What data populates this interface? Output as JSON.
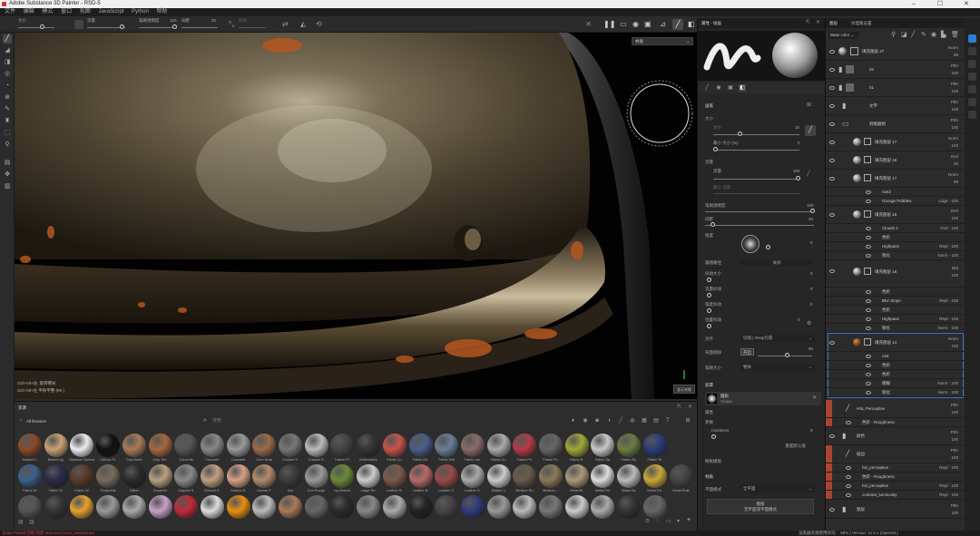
{
  "window": {
    "title": "Adobe Substance 3D Painter - RSD-5",
    "minimize": "–",
    "maximize": "☐",
    "close": "✕"
  },
  "menu": [
    "文件",
    "编辑",
    "模式",
    "窗口",
    "视图",
    "JavaScript",
    "Python",
    "帮助"
  ],
  "tool_options": {
    "size_label": "大小",
    "flow_label": "流量",
    "opacity_label": "笔刷透明度",
    "opacity_value": "100",
    "spacing_label": "间距",
    "spacing_value": "20",
    "jitter_label": "抖动",
    "symmetry_label": "对称"
  },
  "viewport": {
    "dropdown": "材质",
    "hint1": "Ctrl+Alt+左: 旋转曝光",
    "hint2": "Ctrl+Alt+左 平移平整 (#0 )",
    "button": "显示光照"
  },
  "properties": {
    "tabs": [
      "属性 - 绘画"
    ],
    "section_brush": "画笔",
    "size_label": "大小",
    "size_sub": "大小",
    "size_value": "10",
    "size_jitter_label": "最小 大小 (%)",
    "size_jitter_value": "0",
    "flow_section": "流量",
    "flow_label": "流量",
    "flow_value": "100",
    "flow_min_label": "最小 流量",
    "flow_min_value": "",
    "opacity_label": "笔刷透明度",
    "opacity_value": "100",
    "spacing_label": "间距",
    "spacing_value": "20",
    "angle_label": "角度",
    "angle_value": "0",
    "follow_label": "跟随路径",
    "follow_value": "关闭",
    "size_jitter2": "抖动大小",
    "size_jitter2_value": "0",
    "flow_jitter": "流量抖动",
    "flow_jitter_value": "0",
    "angle_jitter": "角度抖动",
    "angle_jitter_value": "0",
    "pos_jitter": "位置抖动",
    "pos_jitter_value": "0",
    "alignment_label": "对齐",
    "alignment_value": "切线 | Wrap包裹",
    "backface_label": "背面剔除",
    "backface_value": "开启",
    "backface_num": "90",
    "symmetry_label": "笔刷大小",
    "symmetry_value": "物体",
    "alpha_section": "遮罩",
    "alpha_name": "圆形",
    "alpha_type": "Shape",
    "alpha_attr": "属性",
    "params": "参数",
    "hardness": "Hardness",
    "hardness_value": "0",
    "reset": "重置默认值",
    "stencil": "网格模版",
    "material": "材质",
    "material_mode": "平面模式",
    "material_value": "全平面",
    "bottom_btn_1": "模版",
    "bottom_btn_2": "无平面或平面模式"
  },
  "layers": {
    "tabs": [
      "图层",
      "纹理集设置"
    ],
    "base_color": "Base color",
    "rows": [
      {
        "name": "填充图层 27",
        "blend": "Norm",
        "val": "98",
        "type": "layer"
      },
      {
        "name": "02",
        "blend": "Pthr",
        "val": "100",
        "type": "folder"
      },
      {
        "name": "01",
        "blend": "Pthr",
        "val": "100",
        "type": "folder"
      },
      {
        "name": "文字",
        "blend": "Pthr",
        "val": "100",
        "type": "folder"
      },
      {
        "name": "划痕磨损",
        "blend": "Pthr",
        "val": "100",
        "type": "folder"
      },
      {
        "name": "填充图层 17",
        "blend": "Norm",
        "val": "100",
        "type": "layer"
      },
      {
        "name": "填充图层 16",
        "blend": "Ovrl",
        "val": "26",
        "type": "layer"
      },
      {
        "name": "填充图层 17",
        "blend": "Norm",
        "val": "89",
        "type": "layer"
      }
    ],
    "subrows_a": [
      {
        "name": "rust2",
        "blend": ""
      },
      {
        "name": "Grunge Pebbles",
        "blend": "Ldge · 100"
      }
    ],
    "rows2": [
      {
        "name": "填充图层 15",
        "blend": "Ovrl",
        "val": "100"
      }
    ],
    "subrows_b": [
      {
        "name": "Clouds 2",
        "blend": "Ovrl · 100"
      },
      {
        "name": "色阶",
        "blend": ""
      },
      {
        "name": "Highpass",
        "blend": "Repl · 100"
      },
      {
        "name": "锐化",
        "blend": "Norm · 100"
      }
    ],
    "rows3": [
      {
        "name": "填充图层 16",
        "blend": "Mul",
        "val": "100"
      }
    ],
    "subrows_c": [
      {
        "name": "色阶",
        "blend": ""
      },
      {
        "name": "Blur Slope",
        "blend": "Repl · 100"
      },
      {
        "name": "色阶",
        "blend": ""
      },
      {
        "name": "Highpass",
        "blend": "Repl · 100"
      },
      {
        "name": "锐化",
        "blend": "Norm · 100"
      }
    ],
    "rows4": [
      {
        "name": "填充图层 14",
        "blend": "Norm",
        "val": "100"
      }
    ],
    "subrows_d": [
      {
        "name": "rust",
        "blend": ""
      },
      {
        "name": "色阶",
        "blend": ""
      },
      {
        "name": "色阶",
        "blend": ""
      },
      {
        "name": "模糊",
        "blend": "Norm · 100"
      },
      {
        "name": "锐化",
        "blend": "Norm · 100"
      }
    ],
    "rows5": [
      {
        "name": "HSL Perceptive",
        "blend": "Pthr",
        "val": "100"
      }
    ],
    "subrows_e": [
      {
        "name": "色阶 - Roughness",
        "blend": ""
      }
    ],
    "rows6": [
      {
        "name": "颜色",
        "blend": "Pthr",
        "val": "100"
      },
      {
        "name": "描边",
        "blend": "Pthr",
        "val": "100"
      }
    ],
    "subrows_f": [
      {
        "name": "hsl_perceptive",
        "blend": "Repl · 100"
      },
      {
        "name": "色阶 - Roughness",
        "blend": ""
      },
      {
        "name": "hsl_perceptive",
        "blend": "Repl · 100"
      },
      {
        "name": "contrast_luminosity",
        "blend": "Repl · 100"
      }
    ],
    "rows7": [
      {
        "name": "图层",
        "blend": "Pthr",
        "val": "100"
      }
    ]
  },
  "shelf": {
    "title": "资源",
    "filter": "All libraries",
    "search_placeholder": "搜索",
    "row1": [
      "Autumn L.",
      "Baked Lig.",
      "Balance Contrast",
      "Carbon Fi.",
      "Clay Earth",
      "Clay Terr.",
      "Concrete",
      "Concrete",
      "Concrete",
      "Corn Husk",
      "Custom S.",
      "Custom S.",
      "Damm Fi.",
      "Embroidery",
      "Fabric Co.",
      "Fabric De.",
      "Fabric Felt",
      "Fabric Lac.",
      "Fabric Lin.",
      "Fabric Pe.",
      "Fabric Po.",
      "Fabric R.",
      "Fabric Sa.",
      "Fabric Sp.",
      "Fabric Te."
    ],
    "row2": [
      "Fabric W.",
      "Fabric W.",
      "Fabric W.",
      "Footprints",
      "Glitter",
      "Gouache",
      "Graphic S.",
      "Ground G.",
      "Ground S.",
      "Human F.",
      "Iron",
      "Iron Rough",
      "Ivy Branch",
      "Large Ro.",
      "Leather B.",
      "Leather B.",
      "Leather S.",
      "Leather S.",
      "Marble V.",
      "Medium Ru.",
      "Medium ...",
      "Metal Br.",
      "Metal Pol.",
      "Metal Sa.",
      "Metal Pol.",
      "Metal Rust"
    ],
    "statusmsg": "[Data Panel] 已经 同步 resource://core_assets/rust"
  },
  "status": {
    "right": "渲染器资源使用状况：  59%  |  Version: 11.0.1 (OpenGL)"
  },
  "colors": {
    "accent": "#2a7fd4",
    "red": "#a84432",
    "rust": "#b4561f"
  }
}
